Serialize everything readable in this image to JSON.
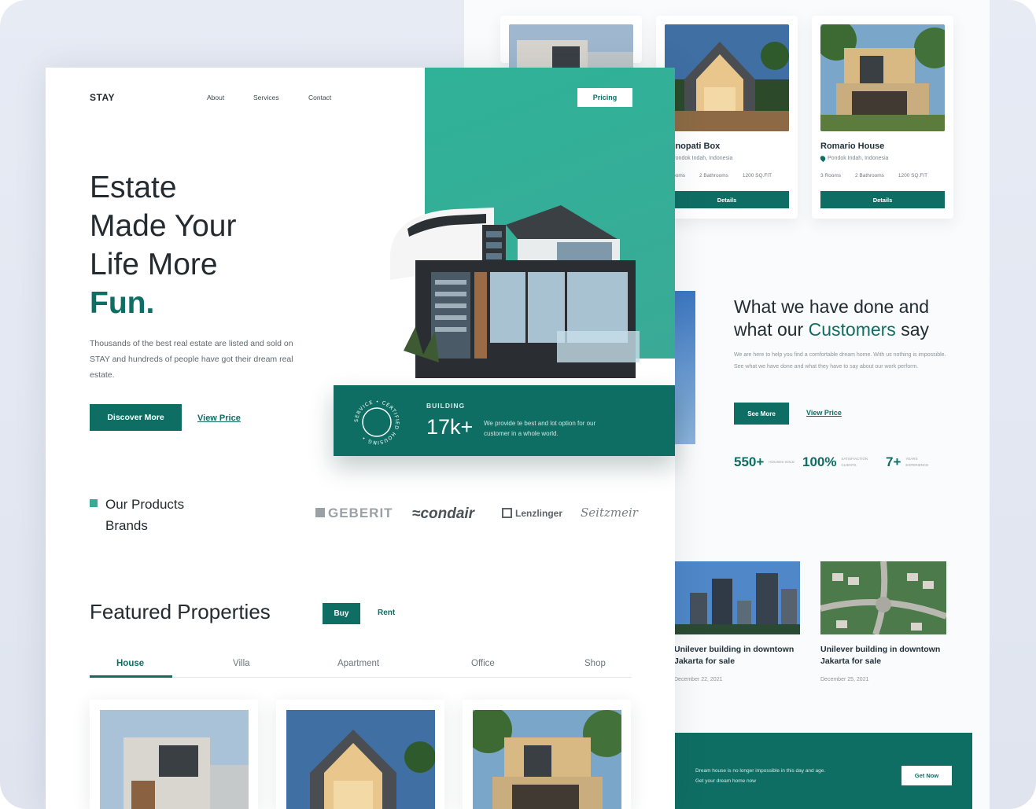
{
  "brand": "STAY",
  "nav": {
    "about": "About",
    "services": "Services",
    "contact": "Contact",
    "pricing": "Pricing"
  },
  "hero": {
    "title_lines": [
      "Estate",
      "Made Your",
      "Life More"
    ],
    "title_highlight": "Fun.",
    "description": "Thousands of the best real estate are listed and sold on STAY and hundreds of people have got their dream real estate.",
    "discover_button": "Discover More",
    "view_price": "View Price"
  },
  "building_stats": {
    "badge_text": "SERVICE • CERTIFIED HOUSING •",
    "label": "BUILDING",
    "count": "17k+",
    "description": "We provide te best and lot option for our customer in a whole world."
  },
  "products": {
    "heading_line1": "Our Products",
    "heading_line2": "Brands",
    "brands": [
      "GEBERIT",
      "condair",
      "Lenzlinger",
      "Seitzmeir"
    ]
  },
  "featured": {
    "title": "Featured Properties",
    "buy": "Buy",
    "rent": "Rent",
    "tabs": [
      "House",
      "Villa",
      "Apartment",
      "Office",
      "Shop"
    ]
  },
  "back_cards": [
    {
      "title": "Senopati Box",
      "location": "Pondok Indah, Indonesia",
      "rooms": "3 Rooms",
      "baths": "2 Bathrooms",
      "area": "1200 SQ.FIT",
      "button": "Details"
    },
    {
      "title": "Romario House",
      "location": "Pondok Indah, Indonesia",
      "rooms": "3 Rooms",
      "baths": "2 Bathrooms",
      "area": "1200 SQ.FIT",
      "button": "Details"
    }
  ],
  "testimonials": {
    "title_line1": "What we have done and",
    "title_line2_pre": "what our ",
    "title_line2_hl": "Customers",
    "title_line2_post": " say",
    "description": "We are here to help you find a comfortable dream home. With us nothing is impossible. See what we have done and what they have to say about our work perform.",
    "see_more": "See More",
    "view_price": "View Price",
    "stats": [
      {
        "value": "550+",
        "label": "Houses Sold"
      },
      {
        "value": "100%",
        "label": "Satisfiaction Clients"
      },
      {
        "value": "7+",
        "label": "Years Experience"
      }
    ]
  },
  "news": [
    {
      "title": "Unilever building in downtown Jakarta for sale",
      "date": "December 22, 2021"
    },
    {
      "title": "Unilever building in downtown Jakarta for sale",
      "date": "December 25, 2021"
    }
  ],
  "cta": {
    "line1": "Dream house is no longer impossible in this day and age.",
    "line2": "Get your dream home now",
    "button": "Get Now"
  },
  "colors": {
    "primary": "#0f6e64",
    "accent": "#3aaa97",
    "background": "#e3e7f1"
  }
}
